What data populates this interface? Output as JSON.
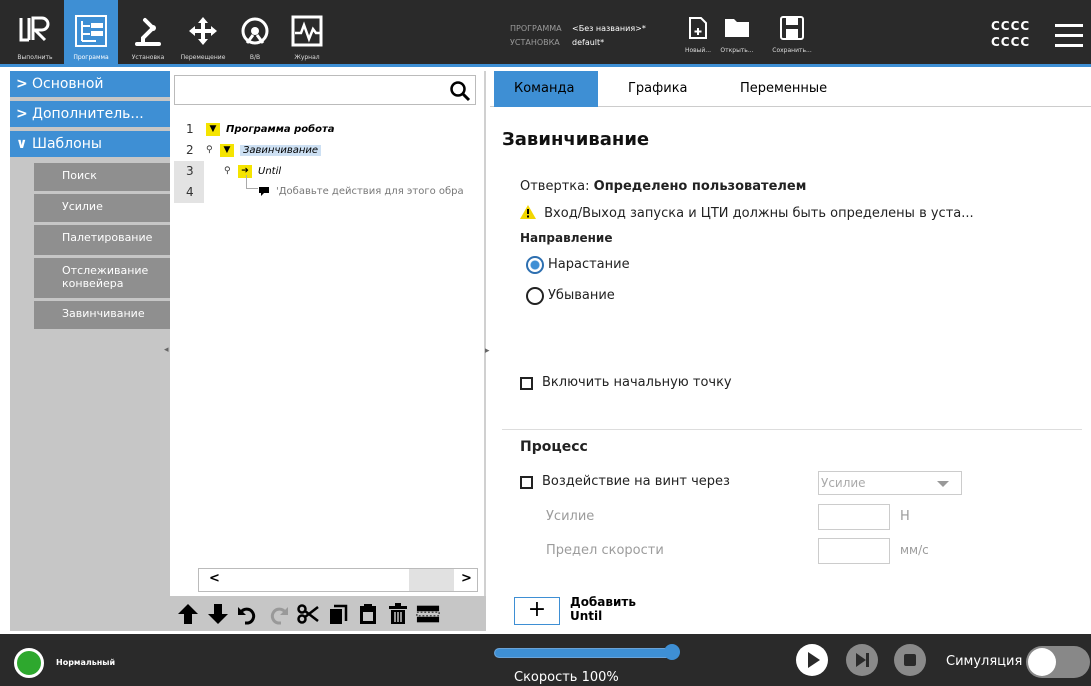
{
  "header": {
    "nav": [
      {
        "label": "Выполнить",
        "icon": "ur-logo-icon"
      },
      {
        "label": "Программа",
        "icon": "program-tree-icon",
        "active": true
      },
      {
        "label": "Установка",
        "icon": "robot-arm-icon"
      },
      {
        "label": "Перемещение",
        "icon": "move-arrows-icon"
      },
      {
        "label": "В/В",
        "icon": "io-gauge-icon"
      },
      {
        "label": "Журнал",
        "icon": "log-chart-icon"
      }
    ],
    "program_key": "ПРОГРАММА",
    "program_value": "<Без названия>*",
    "install_key": "УСТАНОВКА",
    "install_value": "default*",
    "file_buttons": [
      {
        "label": "Новый...",
        "icon": "new-file-icon"
      },
      {
        "label": "Открыть...",
        "icon": "folder-icon"
      },
      {
        "label": "Сохранить...",
        "icon": "save-icon"
      }
    ],
    "robot_name_1": "CCCC",
    "robot_name_2": "CCCC",
    "accent": "#3e8fd4"
  },
  "sidebar": {
    "categories": [
      {
        "label": "Основной",
        "expanded": false
      },
      {
        "label": "Дополнитель...",
        "expanded": false
      },
      {
        "label": "Шаблоны",
        "expanded": true
      }
    ],
    "items": [
      {
        "label": "Поиск"
      },
      {
        "label": "Усилие"
      },
      {
        "label": "Палетирование"
      },
      {
        "label": "Отслеживание конвейера"
      },
      {
        "label": "Завинчивание"
      }
    ]
  },
  "tree": {
    "search_placeholder": "",
    "line_numbers": [
      "1",
      "2",
      "3",
      "4"
    ],
    "nodes": [
      {
        "text": "Программа робота"
      },
      {
        "text": "Завинчивание"
      },
      {
        "text": "Until"
      },
      {
        "text": "'Добавьте действия для этого обра"
      }
    ]
  },
  "command": {
    "tabs": [
      "Команда",
      "Графика",
      "Переменные"
    ],
    "active_tab": "Команда",
    "title": "Завинчивание",
    "driver_label": "Отвертка:",
    "driver_value": "Определено пользователем",
    "warning": "Вход/Выход запуска и ЦТИ должны быть определены в уста...",
    "direction_heading": "Направление",
    "direction_options": [
      "Нарастание",
      "Убывание"
    ],
    "direction_selected": "Нарастание",
    "include_start_label": "Включить начальную точку",
    "process_heading": "Процесс",
    "act_via_label": "Воздействие на винт через",
    "act_via_selected": "Усилие",
    "force_label": "Усилие",
    "force_unit": "Н",
    "speed_limit_label": "Предел скорости",
    "speed_limit_unit": "мм/с",
    "add_label_1": "Добавить",
    "add_label_2": "Until"
  },
  "footer": {
    "status": "Нормальный",
    "speed_label": "Скорость 100%",
    "speed_fraction": 1.0,
    "simulation_label": "Симуляция",
    "simulation_on": false
  }
}
